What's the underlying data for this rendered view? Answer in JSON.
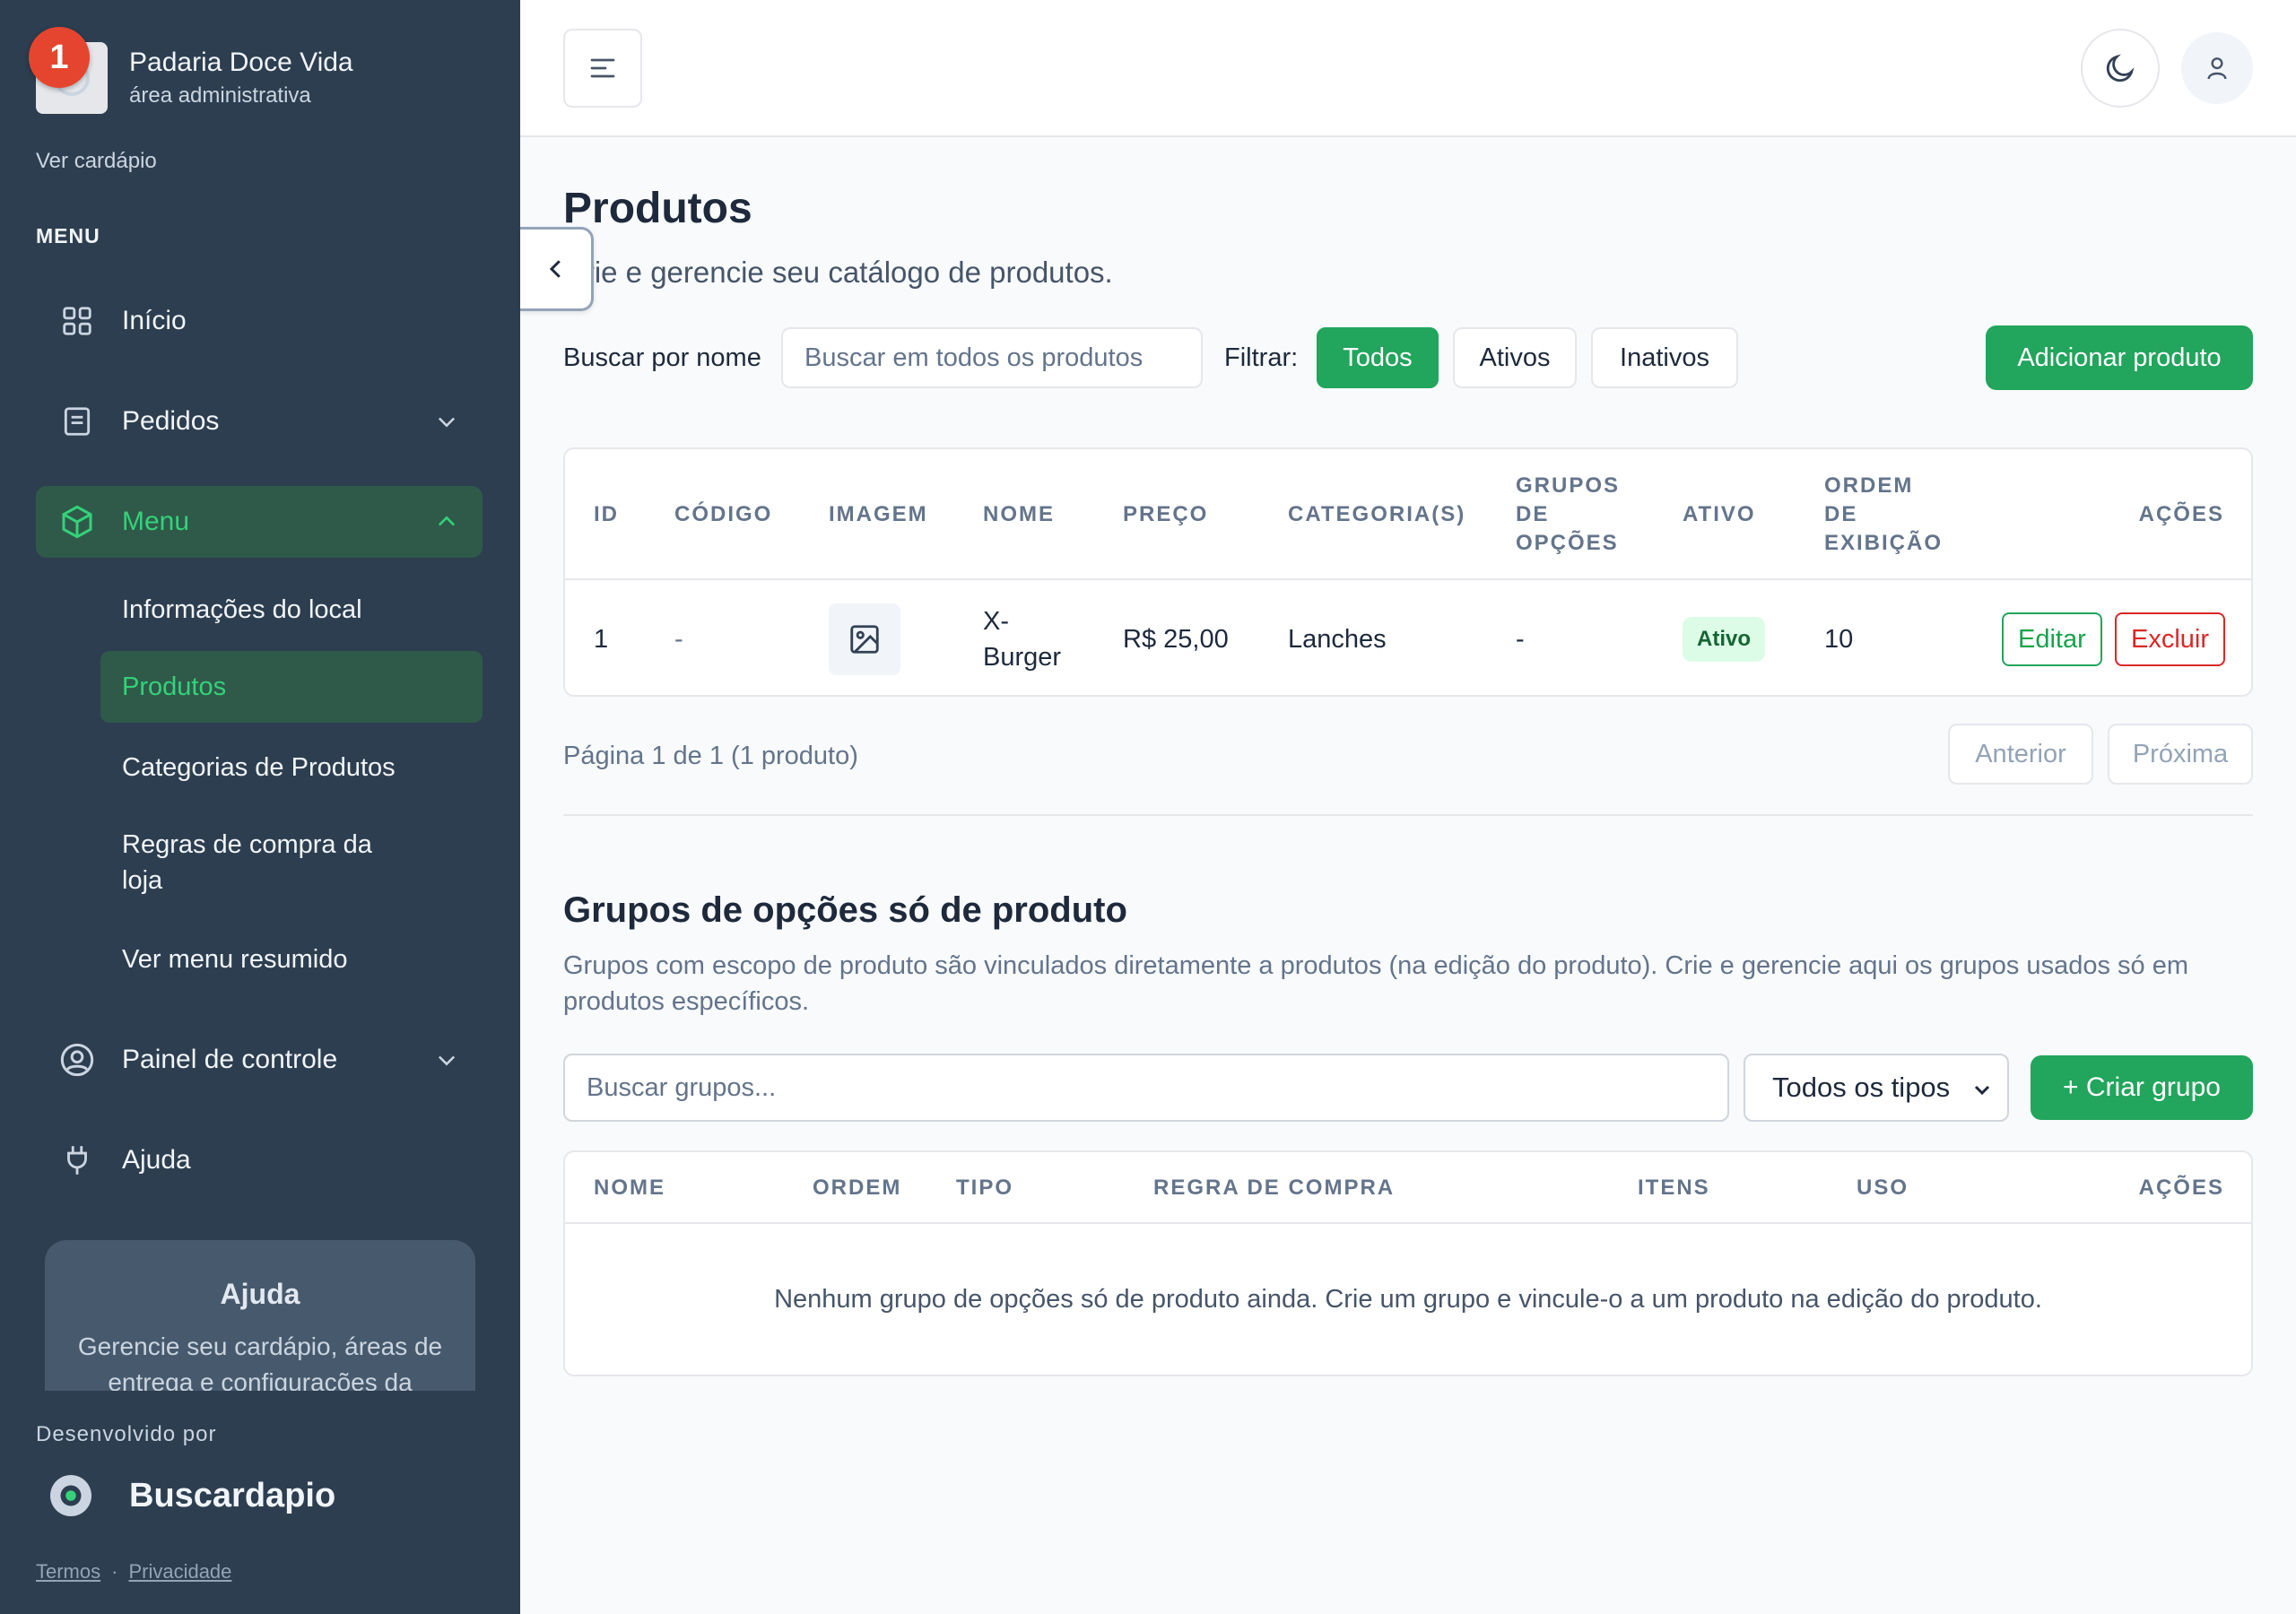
{
  "sidebar": {
    "notification_count": "1",
    "brand_name": "Padaria Doce Vida",
    "brand_sub": "área administrativa",
    "ver_cardapio": "Ver cardápio",
    "menu_heading": "MENU",
    "items": [
      {
        "label": "Início",
        "icon": "grid-icon"
      },
      {
        "label": "Pedidos",
        "icon": "receipt-icon"
      },
      {
        "label": "Menu",
        "icon": "box-icon"
      },
      {
        "label": "Painel de controle",
        "icon": "user-circle-icon"
      },
      {
        "label": "Ajuda",
        "icon": "plug-icon"
      }
    ],
    "menu_sub": [
      "Informações do local",
      "Produtos",
      "Categorias de Produtos",
      "Regras de compra da loja",
      "Ver menu resumido"
    ],
    "help_card": {
      "title": "Ajuda",
      "text": "Gerencie seu cardápio, áreas de entrega e configurações da"
    },
    "dev_by": "Desenvolvido por",
    "dev_name": "Buscardapio",
    "legal": {
      "terms": "Termos",
      "separator": "·",
      "privacy": "Privacidade"
    }
  },
  "page": {
    "title": "Produtos",
    "subtitle": "Crie e gerencie seu catálogo de produtos.",
    "search_label": "Buscar por nome",
    "search_placeholder": "Buscar em todos os produtos",
    "filter_label": "Filtrar:",
    "filters": [
      "Todos",
      "Ativos",
      "Inativos"
    ],
    "active_filter": "Todos",
    "add_button": "Adicionar produto"
  },
  "products_table": {
    "headers": {
      "id": "ID",
      "codigo": "CÓDIGO",
      "imagem": "IMAGEM",
      "nome": "NOME",
      "preco": "PREÇO",
      "categorias": "CATEGORIA(S)",
      "grupos_l1": "GRUPOS",
      "grupos_l2": "DE",
      "grupos_l3": "OPÇÕES",
      "ativo": "ATIVO",
      "ordem_l1": "ORDEM",
      "ordem_l2": "DE",
      "ordem_l3": "EXIBIÇÃO",
      "acoes": "AÇÕES"
    },
    "rows": [
      {
        "id": "1",
        "codigo": "-",
        "nome_l1": "X-",
        "nome_l2": "Burger",
        "preco": "R$ 25,00",
        "categorias": "Lanches",
        "grupos": "-",
        "ativo": "Ativo",
        "ordem": "10",
        "edit": "Editar",
        "delete": "Excluir"
      }
    ],
    "pagination_text": "Página 1 de 1 (1 produto)",
    "prev": "Anterior",
    "next": "Próxima"
  },
  "groups": {
    "title": "Grupos de opções só de produto",
    "description": "Grupos com escopo de produto são vinculados diretamente a produtos (na edição do produto). Crie e gerencie aqui os grupos usados só em produtos específicos.",
    "search_placeholder": "Buscar grupos...",
    "type_select": "Todos os tipos",
    "create_button": "+ Criar grupo",
    "headers": {
      "nome": "NOME",
      "ordem": "ORDEM",
      "tipo": "TIPO",
      "regra": "REGRA DE COMPRA",
      "itens": "ITENS",
      "uso": "USO",
      "acoes": "AÇÕES"
    },
    "empty_message": "Nenhum grupo de opções só de produto ainda. Crie um grupo e vincule-o a um produto na edição do produto."
  },
  "colors": {
    "sidebar_bg": "#2d3e50",
    "accent_green": "#22a55c",
    "danger_red": "#dc2626",
    "badge_red": "#e5452f"
  }
}
